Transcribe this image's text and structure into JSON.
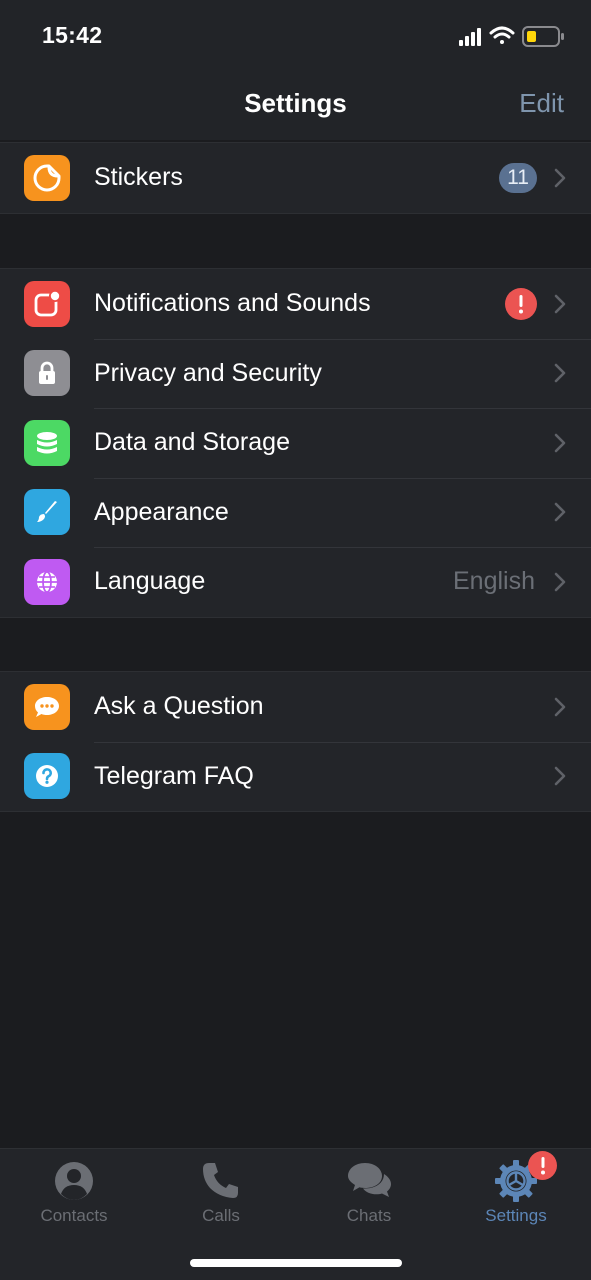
{
  "status_bar": {
    "time": "15:42"
  },
  "header": {
    "title": "Settings",
    "edit_label": "Edit"
  },
  "section_stickers": {
    "items": [
      {
        "label": "Stickers",
        "badge": "11",
        "icon": "sticker-icon",
        "icon_color": "#f7931e"
      }
    ]
  },
  "section_settings": {
    "items": [
      {
        "label": "Notifications and Sounds",
        "alert": "!",
        "icon": "notification-icon",
        "icon_color": "#ee4c46"
      },
      {
        "label": "Privacy and Security",
        "icon": "lock-icon",
        "icon_color": "#8e8e93"
      },
      {
        "label": "Data and Storage",
        "icon": "database-icon",
        "icon_color": "#4cd964"
      },
      {
        "label": "Appearance",
        "icon": "brush-icon",
        "icon_color": "#2fa7e0"
      },
      {
        "label": "Language",
        "value": "English",
        "icon": "globe-icon",
        "icon_color": "#bf5af2"
      }
    ]
  },
  "section_help": {
    "items": [
      {
        "label": "Ask a Question",
        "icon": "chat-bubble-icon",
        "icon_color": "#f7931e"
      },
      {
        "label": "Telegram FAQ",
        "icon": "question-icon",
        "icon_color": "#2fa7e0"
      }
    ]
  },
  "tabbar": {
    "tabs": [
      {
        "label": "Contacts",
        "icon": "person-icon",
        "active": false
      },
      {
        "label": "Calls",
        "icon": "phone-icon",
        "active": false
      },
      {
        "label": "Chats",
        "icon": "chat-bubbles-icon",
        "active": false
      },
      {
        "label": "Settings",
        "icon": "gear-icon",
        "active": true
      }
    ],
    "settings_badge": "!"
  },
  "colors": {
    "accent": "#5c86b7",
    "background": "#1b1c1f",
    "cell": "#232529",
    "alert": "#eb5452"
  }
}
